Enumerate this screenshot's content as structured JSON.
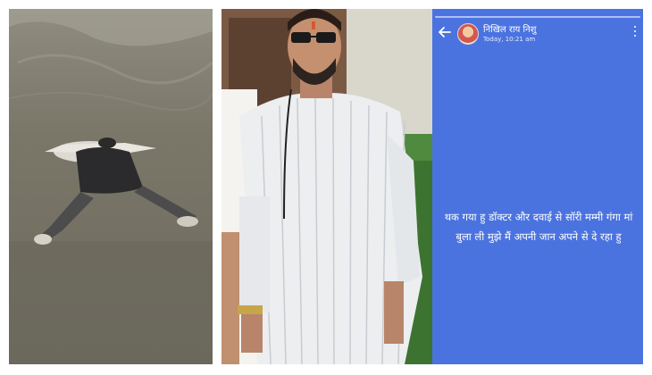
{
  "story": {
    "user_name": "निखिल राय निशु",
    "timestamp": "Today, 10:21 am",
    "status_text": "थक गया हु डॉक्टर और दवाई से सॉरी मम्मी गंगा मां बुला ली मुझे मैं अपनी जान अपने से दे रहा हु",
    "background_color": "#4b73e0",
    "icons": {
      "back": "arrow-left-icon",
      "menu": "more-vertical-icon"
    }
  },
  "photos": {
    "left": "photo of a person floating face-down in river water",
    "middle": "portrait of a man in sunglasses and white striped shirt"
  }
}
